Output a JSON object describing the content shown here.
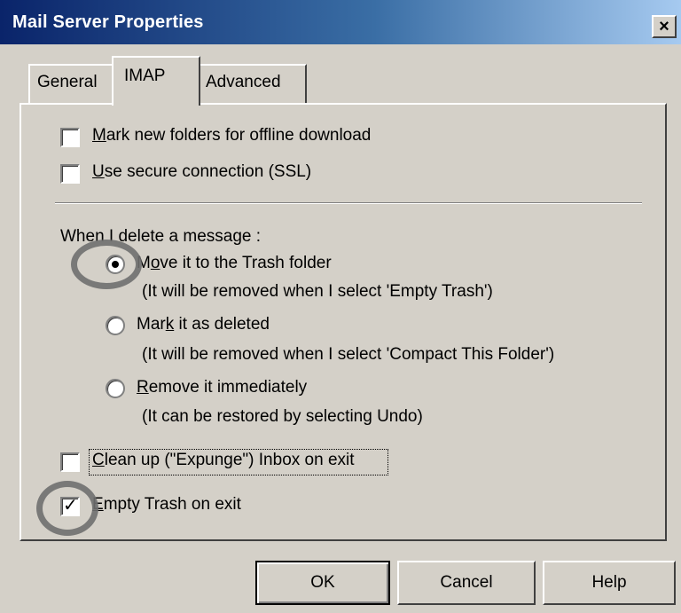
{
  "window": {
    "title": "Mail Server Properties",
    "close_label": "×"
  },
  "tabs": [
    {
      "label": "General"
    },
    {
      "label": "IMAP"
    },
    {
      "label": "Advanced"
    }
  ],
  "options": {
    "offline_download": {
      "label": "Mark new folders for offline download",
      "checked": false
    },
    "ssl": {
      "label": "Use secure connection (SSL)",
      "checked": false
    }
  },
  "delete_section": {
    "heading": "When I delete a message :",
    "choices": [
      {
        "label": "Move it to the Trash folder",
        "hint": "(It will be removed when I select 'Empty Trash')",
        "selected": true
      },
      {
        "label": "Mark it as deleted",
        "hint": "(It will be removed when I select 'Compact This Folder')",
        "selected": false
      },
      {
        "label": "Remove it immediately",
        "hint": "(It can be restored by selecting Undo)",
        "selected": false
      }
    ]
  },
  "exit_options": {
    "expunge": {
      "label": "Clean up (\"Expunge\") Inbox on exit",
      "checked": false
    },
    "empty_trash": {
      "label": "Empty Trash on exit",
      "checked": true
    }
  },
  "buttons": {
    "ok": "OK",
    "cancel": "Cancel",
    "help": "Help"
  }
}
